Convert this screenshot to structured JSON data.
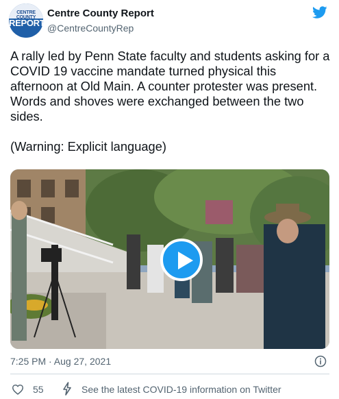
{
  "account": {
    "display_name": "Centre County Report",
    "handle": "@CentreCountyRep",
    "avatar_line1": "CENTRE COUNTY",
    "avatar_line2": "REPORT"
  },
  "tweet": {
    "text": "A rally led by Penn State faculty and students asking for a COVID 19 vaccine mandate turned physical this afternoon at Old Main. A counter protester was present. Words and shoves were exchanged between the two sides.\n\n(Warning: Explicit language)",
    "timestamp": "7:25 PM · Aug 27, 2021"
  },
  "engagement": {
    "likes": "55",
    "covid_notice": "See the latest COVID-19 information on Twitter"
  },
  "icons": {
    "brand": "twitter-bird-icon",
    "info": "info-icon",
    "like": "heart-icon",
    "notice": "lightning-icon",
    "play": "play-icon"
  },
  "colors": {
    "accent": "#1d9bf0",
    "text": "#0f1419",
    "secondary_text": "#536471",
    "divider": "#cfd9de"
  }
}
